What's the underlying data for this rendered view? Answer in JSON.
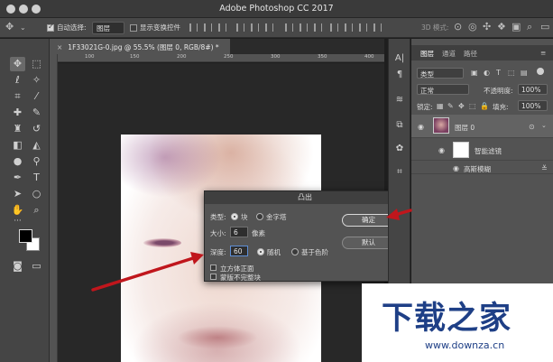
{
  "app": {
    "title": "Adobe Photoshop CC 2017"
  },
  "options_bar": {
    "auto_select_label": "自动选择:",
    "auto_select_value": "图层",
    "show_transform_label": "显示变换控件",
    "mode_3d_label": "3D 模式:"
  },
  "document": {
    "tab_title": "1F33021G-0.jpg @ 55.5% (图层 0, RGB/8#) *",
    "close_glyph": "×"
  },
  "ruler": {
    "ticks": [
      "100",
      "150",
      "200",
      "250",
      "300",
      "350",
      "400"
    ]
  },
  "dialog": {
    "title": "凸出",
    "type_label": "类型:",
    "type_options": [
      "块",
      "金字塔"
    ],
    "type_selected": "块",
    "size_label": "大小:",
    "size_value": "6",
    "size_unit": "像素",
    "depth_label": "深度:",
    "depth_value": "60",
    "depth_options": [
      "随机",
      "基于色阶"
    ],
    "depth_selected": "随机",
    "solid_front_faces_label": "立方体正面",
    "mask_incomplete_label": "蒙版不完整块",
    "ok_label": "确定",
    "default_label": "默认"
  },
  "layers_panel": {
    "tabs": [
      "图层",
      "通道",
      "路径"
    ],
    "active_tab": "图层",
    "filter_kind": "类型",
    "blend_mode": "正常",
    "opacity_label": "不透明度:",
    "opacity_value": "100%",
    "lock_label": "锁定:",
    "fill_label": "填充:",
    "fill_value": "100%",
    "layers": [
      {
        "name": "图层 0"
      },
      {
        "name": "智能滤镜"
      },
      {
        "name": "高斯模糊"
      }
    ]
  },
  "watermark": {
    "logo_text": "下载之家",
    "url": "www.downza.cn"
  },
  "colors": {
    "accent_focus": "#5e8fd6",
    "arrow_red": "#c0161c",
    "watermark_blue": "#1e3f86"
  }
}
